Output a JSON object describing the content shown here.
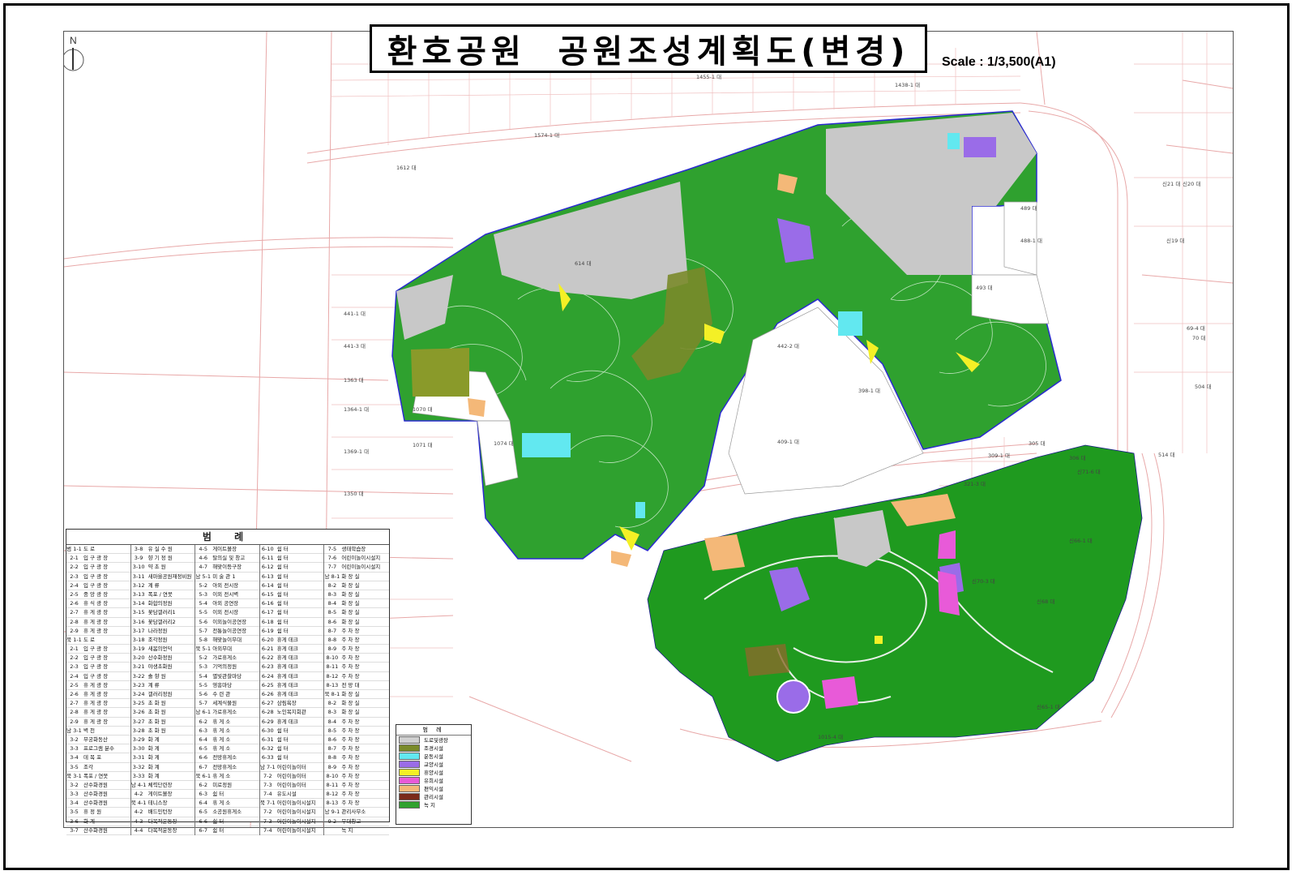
{
  "title": "환호공원  공원조성계획도(변경)",
  "scale_text": "Scale : 1/3,500(A1)",
  "north_label": "N",
  "colors": {
    "road": "#e8a8a8",
    "park_green": "#2fa12f",
    "park_dark_green": "#1f9a1f",
    "plaza_grey": "#c8c8c8",
    "sports_cyan": "#62e8f0",
    "education_purple": "#9a6ce8",
    "rest_yellow": "#f4f026",
    "play_pink": "#e85ad8",
    "convenience_orange": "#f4b878",
    "management_brown": "#7a2a1a",
    "olive": "#8a9a2a"
  },
  "legend": {
    "title": "범 례",
    "columns": [
      [
        {
          "code": "범 1-1",
          "label": "도 로"
        },
        {
          "code": "2-1",
          "label": "입 구 광 장"
        },
        {
          "code": "2-2",
          "label": "입 구 광 장"
        },
        {
          "code": "2-3",
          "label": "입 구 광 장"
        },
        {
          "code": "2-4",
          "label": "입 구 광 장"
        },
        {
          "code": "2-5",
          "label": "중 앙 광 장"
        },
        {
          "code": "2-6",
          "label": "휴 식 광 장"
        },
        {
          "code": "2-7",
          "label": "휴 게 광 장"
        },
        {
          "code": "2-8",
          "label": "휴 게 광 장"
        },
        {
          "code": "2-9",
          "label": "휴 게 광 장"
        },
        {
          "code": "북 1-1",
          "label": "도 로"
        },
        {
          "code": "2-1",
          "label": "입 구 광 장"
        },
        {
          "code": "2-2",
          "label": "입 구 광 장"
        },
        {
          "code": "2-3",
          "label": "입 구 광 장"
        },
        {
          "code": "2-4",
          "label": "입 구 광 장"
        },
        {
          "code": "2-5",
          "label": "휴 게 광 장"
        },
        {
          "code": "2-6",
          "label": "휴 게 광 장"
        },
        {
          "code": "2-7",
          "label": "휴 게 광 장"
        },
        {
          "code": "2-8",
          "label": "휴 게 광 장"
        },
        {
          "code": "2-9",
          "label": "휴 게 광 장"
        },
        {
          "code": "남 3-1",
          "label": "벽 천"
        },
        {
          "code": "3-2",
          "label": "무궁화동산"
        },
        {
          "code": "3-3",
          "label": "프로그램 분수"
        },
        {
          "code": "3-4",
          "label": "데 목 포"
        },
        {
          "code": "3-5",
          "label": "조각"
        },
        {
          "code": "북 3-1",
          "label": "폭포 / 연못"
        },
        {
          "code": "3-2",
          "label": "산수화경원"
        },
        {
          "code": "3-3",
          "label": "산수화경원"
        },
        {
          "code": "3-4",
          "label": "산수화경원"
        },
        {
          "code": "3-5",
          "label": "휴 정 원"
        },
        {
          "code": "3-6",
          "label": "화 계"
        },
        {
          "code": "3-7",
          "label": "산수화경원"
        }
      ],
      [
        {
          "code": "3-8",
          "label": "유 실 수 원"
        },
        {
          "code": "3-9",
          "label": "향 기 정 원"
        },
        {
          "code": "3-10",
          "label": "약 초 원"
        },
        {
          "code": "3-11",
          "label": "새마을공원재정비원"
        },
        {
          "code": "3-12",
          "label": "계 류"
        },
        {
          "code": "3-13",
          "label": "폭포 / 연못"
        },
        {
          "code": "3-14",
          "label": "화합의정원"
        },
        {
          "code": "3-15",
          "label": "꽃담갤러리1"
        },
        {
          "code": "3-16",
          "label": "꽃담갤러리2"
        },
        {
          "code": "3-17",
          "label": "나라정원"
        },
        {
          "code": "3-18",
          "label": "조각정원"
        },
        {
          "code": "3-19",
          "label": "새봄의언덕"
        },
        {
          "code": "3-20",
          "label": "산수화정원"
        },
        {
          "code": "3-21",
          "label": "야생초화원"
        },
        {
          "code": "3-22",
          "label": "솔 향 원"
        },
        {
          "code": "3-23",
          "label": "계 류"
        },
        {
          "code": "3-24",
          "label": "갤러리정원"
        },
        {
          "code": "3-25",
          "label": "초 화 원"
        },
        {
          "code": "3-26",
          "label": "초 화 원"
        },
        {
          "code": "3-27",
          "label": "초 화 원"
        },
        {
          "code": "3-28",
          "label": "초 화 원"
        },
        {
          "code": "3-29",
          "label": "화 계"
        },
        {
          "code": "3-30",
          "label": "화 계"
        },
        {
          "code": "3-31",
          "label": "화 계"
        },
        {
          "code": "3-32",
          "label": "화 계"
        },
        {
          "code": "3-33",
          "label": "화 계"
        },
        {
          "code": "남 4-1",
          "label": "체력단련장"
        },
        {
          "code": "4-2",
          "label": "게이트볼장"
        },
        {
          "code": "북 4-1",
          "label": "테니스장"
        },
        {
          "code": "4-2",
          "label": "배드민턴장"
        },
        {
          "code": "4-3",
          "label": "다목적운동장"
        },
        {
          "code": "4-4",
          "label": "다목적운동장"
        }
      ],
      [
        {
          "code": "4-5",
          "label": "게이트볼장"
        },
        {
          "code": "4-6",
          "label": "탈의실 및 창고"
        },
        {
          "code": "4-7",
          "label": "해맞이등구장"
        },
        {
          "code": "남 5-1",
          "label": "미 술 관 1"
        },
        {
          "code": "5-2",
          "label": "아외 전시장"
        },
        {
          "code": "5-3",
          "label": "이외 전시벽"
        },
        {
          "code": "5-4",
          "label": "아외 공연장"
        },
        {
          "code": "5-5",
          "label": "이외 전시장"
        },
        {
          "code": "5-6",
          "label": "이외놀이공연장"
        },
        {
          "code": "5-7",
          "label": "전통놀이공연장"
        },
        {
          "code": "5-8",
          "label": "해맞놀이무대"
        },
        {
          "code": "북 5-1",
          "label": "아외무대"
        },
        {
          "code": "5-2",
          "label": "가로휴게소"
        },
        {
          "code": "5-3",
          "label": "기억의정원"
        },
        {
          "code": "5-4",
          "label": "별빛관찰마당"
        },
        {
          "code": "5-5",
          "label": "영흥마당"
        },
        {
          "code": "5-6",
          "label": "수 련 관"
        },
        {
          "code": "5-7",
          "label": "세계식물원"
        },
        {
          "code": "남 6-1",
          "label": "가로휴게소"
        },
        {
          "code": "6-2",
          "label": "휴 게 소"
        },
        {
          "code": "6-3",
          "label": "휴 게 소"
        },
        {
          "code": "6-4",
          "label": "휴 게 소"
        },
        {
          "code": "6-5",
          "label": "휴 게 소"
        },
        {
          "code": "6-6",
          "label": "전망휴게소"
        },
        {
          "code": "6-7",
          "label": "전망휴게소"
        },
        {
          "code": "북 6-1",
          "label": "휴 게 소"
        },
        {
          "code": "6-2",
          "label": "미로정원"
        },
        {
          "code": "6-3",
          "label": "쉼 터"
        },
        {
          "code": "6-4",
          "label": "휴 게 소"
        },
        {
          "code": "6-5",
          "label": "소공원휴게소"
        },
        {
          "code": "6-6",
          "label": "쉼 터"
        },
        {
          "code": "6-7",
          "label": "쉼 터"
        }
      ],
      [
        {
          "code": "6-10",
          "label": "쉼 터"
        },
        {
          "code": "6-11",
          "label": "쉼 터"
        },
        {
          "code": "6-12",
          "label": "쉼 터"
        },
        {
          "code": "6-13",
          "label": "쉼 터"
        },
        {
          "code": "6-14",
          "label": "쉼 터"
        },
        {
          "code": "6-15",
          "label": "쉼 터"
        },
        {
          "code": "6-16",
          "label": "쉼 터"
        },
        {
          "code": "6-17",
          "label": "쉼 터"
        },
        {
          "code": "6-18",
          "label": "쉼 터"
        },
        {
          "code": "6-19",
          "label": "쉼 터"
        },
        {
          "code": "6-20",
          "label": "휴게 데크"
        },
        {
          "code": "6-21",
          "label": "휴게 데크"
        },
        {
          "code": "6-22",
          "label": "휴게 데크"
        },
        {
          "code": "6-23",
          "label": "휴게 데크"
        },
        {
          "code": "6-24",
          "label": "휴게 데크"
        },
        {
          "code": "6-25",
          "label": "휴게 데크"
        },
        {
          "code": "6-26",
          "label": "휴게 데크"
        },
        {
          "code": "6-27",
          "label": "삼림욕장"
        },
        {
          "code": "6-28",
          "label": "노인복지회관"
        },
        {
          "code": "6-29",
          "label": "휴게 데크"
        },
        {
          "code": "6-30",
          "label": "쉼 터"
        },
        {
          "code": "6-31",
          "label": "쉼 터"
        },
        {
          "code": "6-32",
          "label": "쉼 터"
        },
        {
          "code": "6-33",
          "label": "쉼 터"
        },
        {
          "code": "남 7-1",
          "label": "어린이놀이터"
        },
        {
          "code": "7-2",
          "label": "어린이놀이터"
        },
        {
          "code": "7-3",
          "label": "어린이놀이터"
        },
        {
          "code": "7-4",
          "label": "유도시설"
        },
        {
          "code": "북 7-1",
          "label": "어린이놀이시설지"
        },
        {
          "code": "7-2",
          "label": "어린이놀이시설지"
        },
        {
          "code": "7-3",
          "label": "어린이놀이시설지"
        },
        {
          "code": "7-4",
          "label": "어린이놀이시설지"
        }
      ],
      [
        {
          "code": "7-5",
          "label": "생태학습장"
        },
        {
          "code": "7-6",
          "label": "어린이놀이시설지"
        },
        {
          "code": "7-7",
          "label": "어린이놀이시설지"
        },
        {
          "code": "남 8-1",
          "label": "화 장 실"
        },
        {
          "code": "8-2",
          "label": "화 장 실"
        },
        {
          "code": "8-3",
          "label": "화 장 실"
        },
        {
          "code": "8-4",
          "label": "화 장 실"
        },
        {
          "code": "8-5",
          "label": "화 장 실"
        },
        {
          "code": "8-6",
          "label": "화 장 실"
        },
        {
          "code": "8-7",
          "label": "주 차 장"
        },
        {
          "code": "8-8",
          "label": "주 차 장"
        },
        {
          "code": "8-9",
          "label": "주 차 장"
        },
        {
          "code": "8-10",
          "label": "주 차 장"
        },
        {
          "code": "8-11",
          "label": "주 차 장"
        },
        {
          "code": "8-12",
          "label": "주 차 장"
        },
        {
          "code": "8-13",
          "label": "전 망 대"
        },
        {
          "code": "북 8-1",
          "label": "화 장 실"
        },
        {
          "code": "8-2",
          "label": "화 장 실"
        },
        {
          "code": "8-3",
          "label": "화 장 실"
        },
        {
          "code": "8-4",
          "label": "주 차 장"
        },
        {
          "code": "8-5",
          "label": "주 차 장"
        },
        {
          "code": "8-6",
          "label": "주 차 장"
        },
        {
          "code": "8-7",
          "label": "주 차 장"
        },
        {
          "code": "8-8",
          "label": "주 차 장"
        },
        {
          "code": "8-9",
          "label": "주 차 장"
        },
        {
          "code": "8-10",
          "label": "주 차 장"
        },
        {
          "code": "8-11",
          "label": "주 차 장"
        },
        {
          "code": "8-12",
          "label": "주 차 장"
        },
        {
          "code": "8-13",
          "label": "주 차 장"
        },
        {
          "code": "남 9-1",
          "label": "관리사무소"
        },
        {
          "code": "9-2",
          "label": "무대창고"
        },
        {
          "code": "",
          "label": "녹 지"
        }
      ]
    ]
  },
  "facility_legend": {
    "title": "범 례",
    "items": [
      {
        "label": "도로및광장",
        "color": "#d0d0d0"
      },
      {
        "label": "조경시설",
        "color": "#7a8a2a"
      },
      {
        "label": "운동시설",
        "color": "#62e8f0"
      },
      {
        "label": "교양시설",
        "color": "#9a6ce8"
      },
      {
        "label": "휴양시설",
        "color": "#f4f026"
      },
      {
        "label": "유희시설",
        "color": "#e85ad8"
      },
      {
        "label": "편익시설",
        "color": "#f4b878"
      },
      {
        "label": "관리시설",
        "color": "#7a2a1a"
      },
      {
        "label": "녹 지",
        "color": "#2fa12f"
      }
    ]
  },
  "parcel_labels": [
    "1455-1 대",
    "1438-1 대",
    "1574-1 대",
    "1612 대",
    "614 대",
    "441-1 대",
    "441-3 대",
    "1363 대",
    "1364-1 대",
    "1070 대",
    "1071 대",
    "1074 대",
    "1350 대",
    "1369-1 대",
    "442-2 대",
    "398-1 대",
    "409-1 대",
    "493 대",
    "489 대",
    "488-1 대",
    "신19 대",
    "신21 대",
    "신20 대",
    "69-4 대",
    "70 대",
    "504 대",
    "514 대",
    "신71-6 대",
    "신66-1 대",
    "신70-3 대",
    "신68 대",
    "신65-1 대",
    "1015-4 대",
    "306 대",
    "305 대",
    "309-1 대",
    "321-3 대"
  ]
}
